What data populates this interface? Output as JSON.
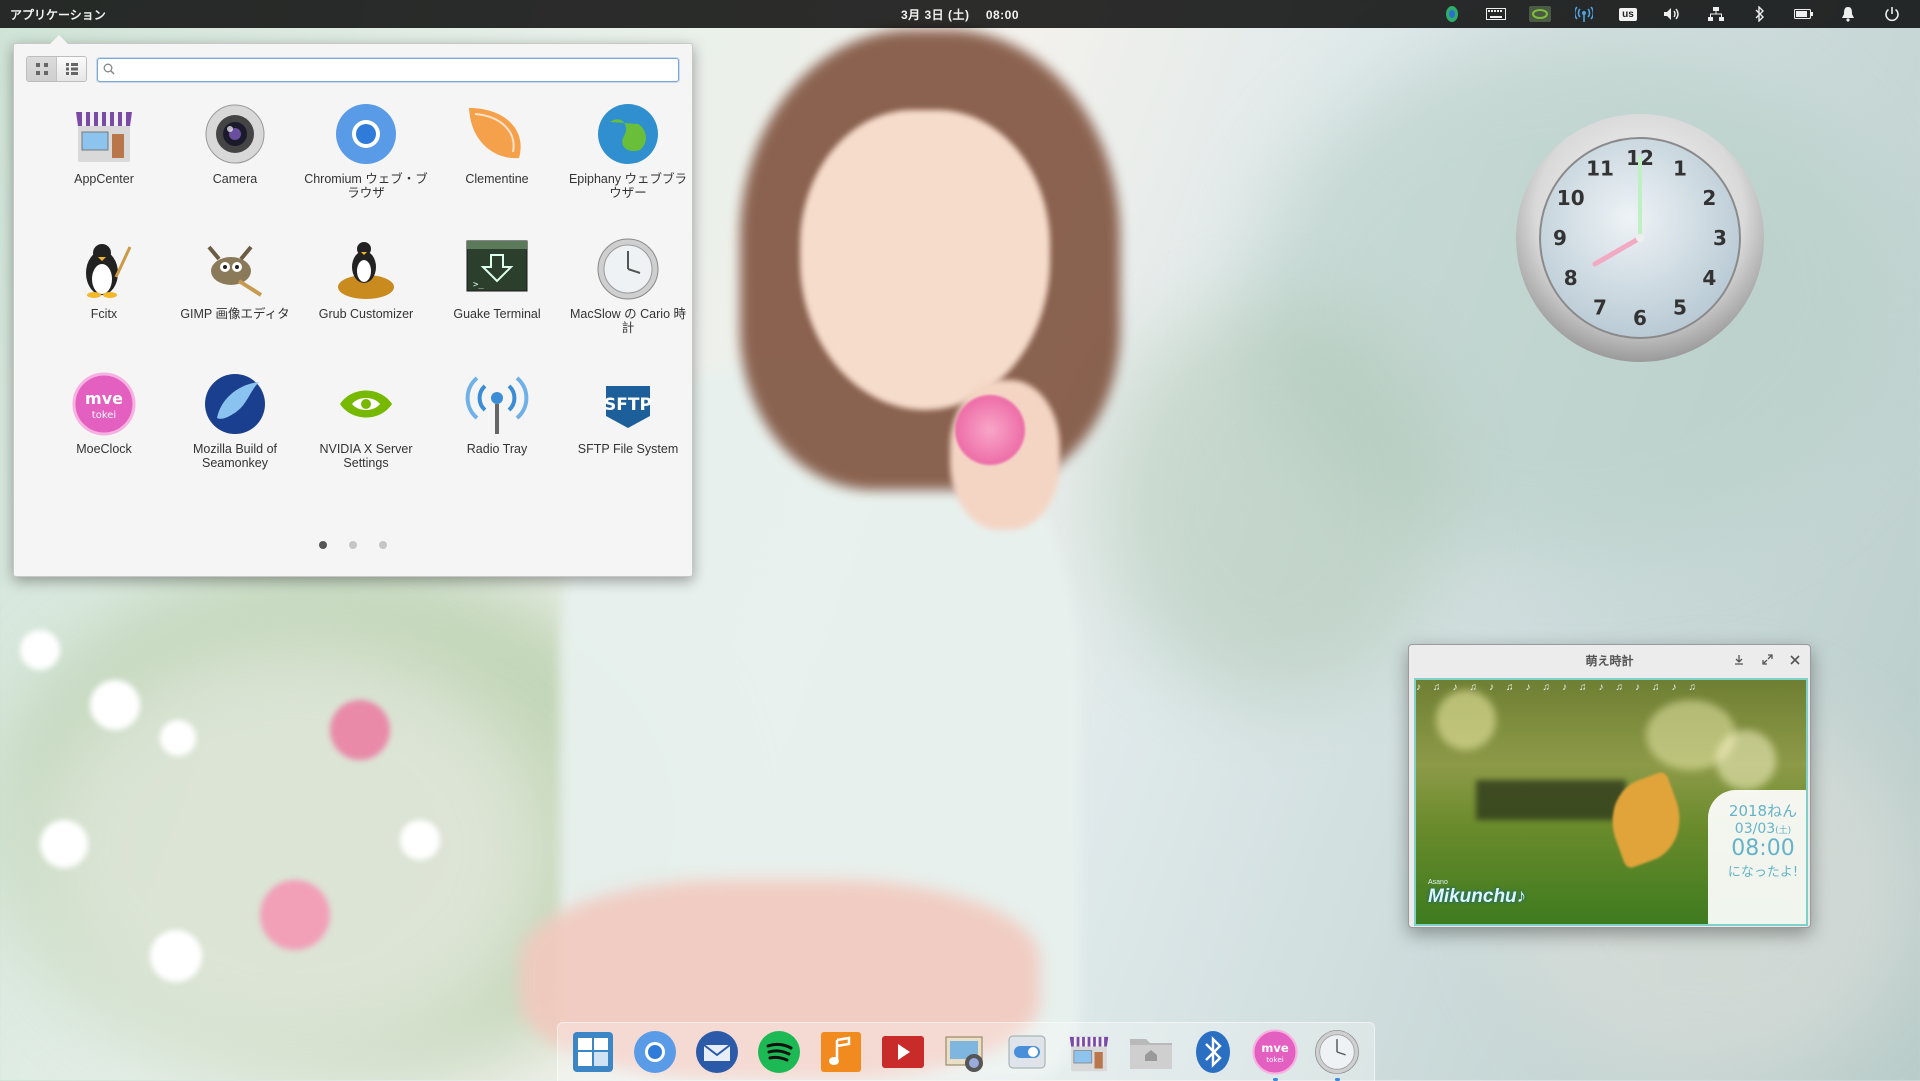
{
  "topbar": {
    "apps_label": "アプリケーション",
    "clock": "3月 3日 (土)　 08:00",
    "tray": [
      {
        "icon": "fcitx-tray-icon"
      },
      {
        "icon": "keyboard-icon"
      },
      {
        "icon": "nvidia-tray-icon"
      },
      {
        "icon": "radio-tray-icon"
      },
      {
        "icon": "keyboard-layout-us",
        "label": "us"
      },
      {
        "icon": "volume-icon"
      },
      {
        "icon": "network-icon"
      },
      {
        "icon": "bluetooth-icon"
      },
      {
        "icon": "battery-icon"
      },
      {
        "icon": "notification-bell-icon"
      },
      {
        "icon": "power-icon"
      }
    ]
  },
  "launcher": {
    "search_value": "",
    "view_modes": [
      "grid-view",
      "category-view"
    ],
    "apps": [
      {
        "label": "AppCenter",
        "icon": "appcenter-icon"
      },
      {
        "label": "Camera",
        "icon": "camera-icon"
      },
      {
        "label": "Chromium ウェブ・ブラウザ",
        "icon": "chromium-icon"
      },
      {
        "label": "Clementine",
        "icon": "clementine-icon"
      },
      {
        "label": "Epiphany ウェブブラウザー",
        "icon": "epiphany-icon"
      },
      {
        "label": "Fcitx",
        "icon": "fcitx-icon"
      },
      {
        "label": "GIMP 画像エディタ",
        "icon": "gimp-icon"
      },
      {
        "label": "Grub Customizer",
        "icon": "grub-customizer-icon"
      },
      {
        "label": "Guake Terminal",
        "icon": "guake-terminal-icon"
      },
      {
        "label": "MacSlow の Cario 時計",
        "icon": "cairo-clock-icon"
      },
      {
        "label": "MoeClock",
        "icon": "moeclock-icon"
      },
      {
        "label": "Mozilla Build of Seamonkey",
        "icon": "seamonkey-icon"
      },
      {
        "label": "NVIDIA X Server Settings",
        "icon": "nvidia-settings-icon"
      },
      {
        "label": "Radio Tray",
        "icon": "radio-tray-icon"
      },
      {
        "label": "SFTP File System",
        "icon": "sftp-icon",
        "icon_text": "SFTP"
      }
    ],
    "pages": 3,
    "current_page": 1
  },
  "clock_widget": {
    "numbers": [
      "12",
      "1",
      "2",
      "3",
      "4",
      "5",
      "6",
      "7",
      "8",
      "9",
      "10",
      "11"
    ],
    "hour": 8,
    "minute": 0
  },
  "moe_window": {
    "title": "萌え時計",
    "buttons": [
      "minimize-icon",
      "maximize-icon",
      "close-icon"
    ],
    "brand": "Mikunchu♪",
    "brand_small": "Asano",
    "year": "2018ねん",
    "date": "03/03",
    "weekday": "(土)",
    "time": "08:00",
    "message": "になったよ!"
  },
  "dock": {
    "items": [
      {
        "name": "multitasking-view",
        "icon": "multitasking-icon"
      },
      {
        "name": "chromium",
        "icon": "chromium-icon"
      },
      {
        "name": "thunderbird",
        "icon": "thunderbird-icon"
      },
      {
        "name": "spotify",
        "icon": "spotify-icon"
      },
      {
        "name": "music",
        "icon": "music-icon"
      },
      {
        "name": "videos",
        "icon": "videos-icon"
      },
      {
        "name": "photos",
        "icon": "photos-icon"
      },
      {
        "name": "system-settings",
        "icon": "settings-icon"
      },
      {
        "name": "appcenter",
        "icon": "appcenter-icon"
      },
      {
        "name": "files",
        "icon": "files-icon"
      },
      {
        "name": "bluetooth",
        "icon": "bluetooth-icon"
      },
      {
        "name": "moeclock",
        "icon": "moeclock-icon",
        "running": true
      },
      {
        "name": "cairo-clock",
        "icon": "cairo-clock-icon",
        "running": true
      }
    ]
  },
  "colors": {
    "accent": "#3b8ad9",
    "panel": "#000000",
    "moe_teal": "#66b3c9"
  }
}
